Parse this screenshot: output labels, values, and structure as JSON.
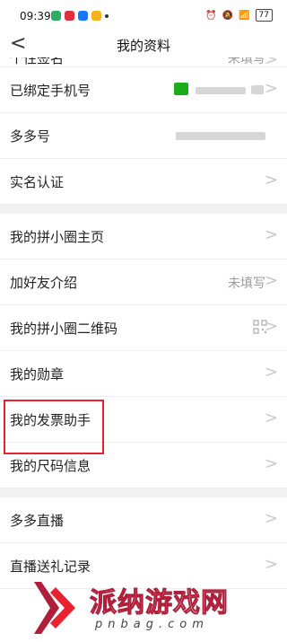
{
  "status_bar": {
    "time": "09:39",
    "battery": "77"
  },
  "header": {
    "back_label": "<",
    "title": "我的资料"
  },
  "partial_row": {
    "label": "个性签名",
    "value": "未填写"
  },
  "rows_group1": [
    {
      "label": "已绑定手机号",
      "value": ""
    },
    {
      "label": "多多号",
      "value": ""
    },
    {
      "label": "实名认证",
      "value": ""
    }
  ],
  "rows_group2": [
    {
      "label": "我的拼小圈主页",
      "value": ""
    },
    {
      "label": "加好友介绍",
      "value": "未填写"
    },
    {
      "label": "我的拼小圈二维码",
      "value": ""
    },
    {
      "label": "我的勋章",
      "value": ""
    },
    {
      "label": "我的发票助手",
      "value": ""
    },
    {
      "label": "我的尺码信息",
      "value": ""
    }
  ],
  "rows_group3": [
    {
      "label": "多多直播",
      "value": ""
    },
    {
      "label": "直播送礼记录",
      "value": ""
    }
  ],
  "chevron": ">",
  "watermark": {
    "title": "派纳游戏网",
    "subtitle": "pnbag.com"
  },
  "colors": {
    "highlight": "#e8232f",
    "section_gap": "#f2f2f2",
    "wechat_green": "#1aad19"
  }
}
